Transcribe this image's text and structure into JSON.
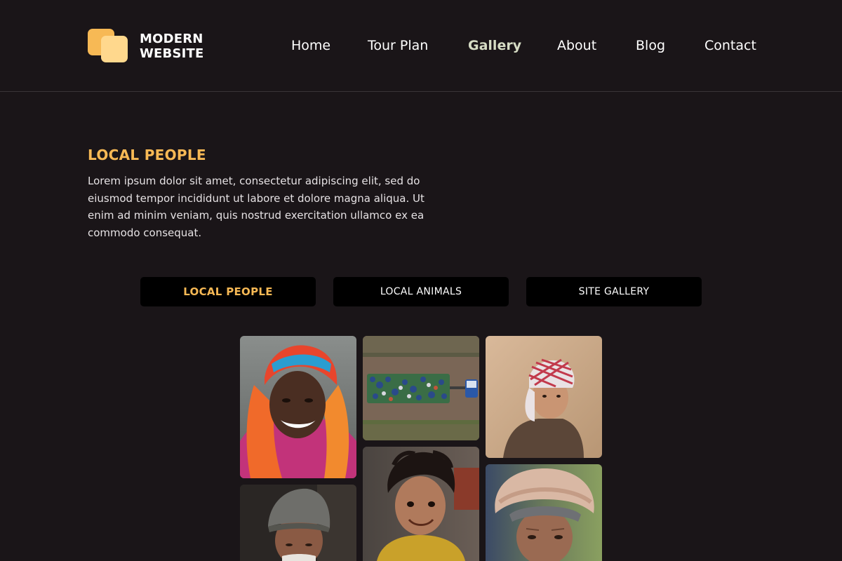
{
  "brand": {
    "line1": "MODERN",
    "line2": "WEBSITE",
    "colors": {
      "primary": "#f7b955",
      "secondary": "#ffd88d"
    }
  },
  "nav": {
    "items": [
      {
        "label": "Home"
      },
      {
        "label": "Tour Plan"
      },
      {
        "label": "Gallery"
      },
      {
        "label": "About"
      },
      {
        "label": "Blog"
      },
      {
        "label": "Contact"
      }
    ],
    "active": "Gallery"
  },
  "intro": {
    "title": "LOCAL PEOPLE",
    "description": "Lorem ipsum dolor sit amet, consectetur adipiscing elit, sed do eiusmod tempor incididunt ut labore et dolore magna aliqua. Ut enim ad minim veniam, quis nostrud exercitation ullamco ex ea commodo consequat."
  },
  "tabs": {
    "items": [
      {
        "label": "LOCAL PEOPLE"
      },
      {
        "label": "LOCAL ANIMALS"
      },
      {
        "label": "SITE GALLERY"
      }
    ],
    "active": "LOCAL PEOPLE"
  },
  "colors": {
    "background": "#1a1518",
    "accent": "#f7b955",
    "active_nav": "#d6dcc4",
    "tab_background": "#000000"
  },
  "gallery": {
    "photos": [
      {
        "subject": "smiling-woman-orange-headscarf"
      },
      {
        "subject": "aerial-crowd-on-trailer"
      },
      {
        "subject": "boy-red-white-keffiyeh"
      },
      {
        "subject": "old-man-grey-cap"
      },
      {
        "subject": "smiling-child-yellow-sweater"
      },
      {
        "subject": "old-man-turban"
      }
    ]
  }
}
